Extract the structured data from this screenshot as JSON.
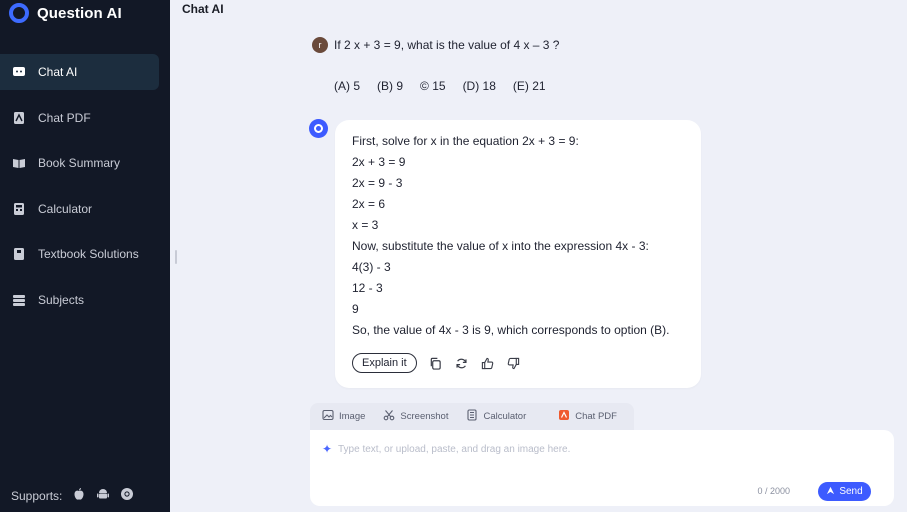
{
  "app": {
    "name": "Question AI"
  },
  "sidebar": {
    "items": [
      {
        "label": "Chat AI",
        "icon": "chat-icon",
        "active": true
      },
      {
        "label": "Chat PDF",
        "icon": "pdf-icon"
      },
      {
        "label": "Book Summary",
        "icon": "book-icon"
      },
      {
        "label": "Calculator",
        "icon": "calculator-icon"
      },
      {
        "label": "Textbook Solutions",
        "icon": "textbook-icon"
      },
      {
        "label": "Subjects",
        "icon": "layers-icon"
      }
    ],
    "supports_label": "Supports:",
    "platforms": [
      "apple-icon",
      "android-icon",
      "chrome-icon"
    ]
  },
  "main": {
    "title": "Chat AI",
    "question": {
      "avatar_letter": "r",
      "text": "If 2 x + 3 = 9, what is the value of 4 x – 3 ?",
      "options": [
        "(A) 5",
        "(B) 9",
        "© 15",
        "(D) 18",
        "(E) 21"
      ]
    },
    "answer": {
      "lines": [
        "First, solve for x in the equation 2x + 3 = 9:",
        "2x + 3 = 9",
        "2x = 9 - 3",
        "2x = 6",
        "x = 3",
        "Now, substitute the value of x into the expression 4x - 3:",
        "4(3) - 3",
        "12 - 3",
        "9",
        "So, the value of 4x - 3 is 9, which corresponds to option (B)."
      ],
      "explain_label": "Explain it"
    },
    "input": {
      "tools": [
        "Image",
        "Screenshot",
        "Calculator",
        "Chat PDF"
      ],
      "placeholder": "Type text, or upload, paste, and drag an image here.",
      "char_count": "0 / 2000",
      "send_label": "Send"
    }
  },
  "colors": {
    "sidebar_bg": "#121826",
    "accent": "#3d5bff",
    "main_bg": "#eef0f8"
  }
}
